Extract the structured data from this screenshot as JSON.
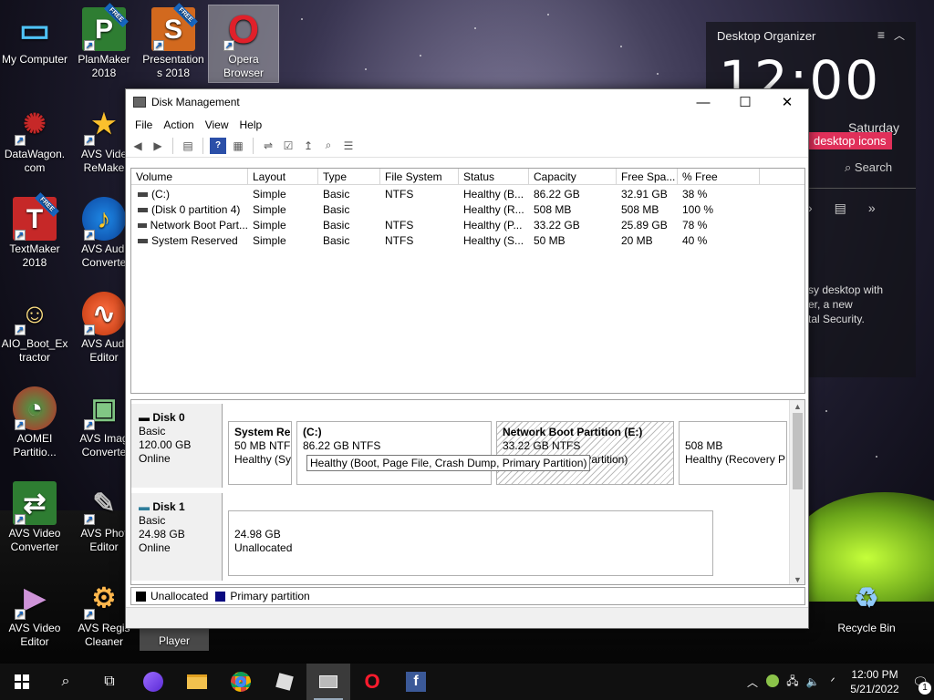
{
  "desktop": {
    "icons": [
      {
        "label": "My Computer",
        "glyph": "▭"
      },
      {
        "label": "PlanMaker 2018",
        "glyph": "P",
        "badge": "FREE"
      },
      {
        "label": "Presentation s 2018",
        "glyph": "S",
        "badge": "FREE"
      },
      {
        "label": "Opera Browser",
        "glyph": "O"
      },
      {
        "label": "DataWagon. com",
        "glyph": "✺"
      },
      {
        "label": "AVS Vide ReMake",
        "glyph": "★"
      },
      {
        "label": "TextMaker 2018",
        "glyph": "T",
        "badge": "FREE"
      },
      {
        "label": "AVS Audi Converte",
        "glyph": "♪"
      },
      {
        "label": "AIO_Boot_Ex tractor",
        "glyph": "☺"
      },
      {
        "label": "AVS Audi Editor",
        "glyph": "∿"
      },
      {
        "label": "AOMEI Partitio...",
        "glyph": "◔"
      },
      {
        "label": "AVS Imag Converte",
        "glyph": "▣"
      },
      {
        "label": "AVS Video Converter",
        "glyph": "⇄"
      },
      {
        "label": "AVS Phot Editor",
        "glyph": "✎"
      },
      {
        "label": "AVS Video Editor",
        "glyph": "▶"
      },
      {
        "label": "AVS Regis Cleaner",
        "glyph": "⚙"
      },
      {
        "label": "Player",
        "glyph": ""
      },
      {
        "label": "Recycle Bin",
        "glyph": "♻"
      }
    ]
  },
  "organizer": {
    "title": "Desktop Organizer",
    "clock": "12:00",
    "day": "Saturday",
    "badge": "desktop icons",
    "search": "Search",
    "text_lines": [
      "sy desktop with",
      "er, a new",
      "tal Security."
    ]
  },
  "window": {
    "title": "Disk Management",
    "menu": [
      "File",
      "Action",
      "View",
      "Help"
    ],
    "columns": [
      "Volume",
      "Layout",
      "Type",
      "File System",
      "Status",
      "Capacity",
      "Free Spa...",
      "% Free"
    ],
    "volumes": [
      {
        "volume": "(C:)",
        "layout": "Simple",
        "type": "Basic",
        "fs": "NTFS",
        "status": "Healthy (B...",
        "capacity": "86.22 GB",
        "free": "32.91 GB",
        "pct": "38 %"
      },
      {
        "volume": "(Disk 0 partition 4)",
        "layout": "Simple",
        "type": "Basic",
        "fs": "",
        "status": "Healthy (R...",
        "capacity": "508 MB",
        "free": "508 MB",
        "pct": "100 %"
      },
      {
        "volume": "Network Boot Part...",
        "layout": "Simple",
        "type": "Basic",
        "fs": "NTFS",
        "status": "Healthy (P...",
        "capacity": "33.22 GB",
        "free": "25.89 GB",
        "pct": "78 %"
      },
      {
        "volume": "System Reserved",
        "layout": "Simple",
        "type": "Basic",
        "fs": "NTFS",
        "status": "Healthy (S...",
        "capacity": "50 MB",
        "free": "20 MB",
        "pct": "40 %"
      }
    ],
    "disks": [
      {
        "name": "Disk 0",
        "type": "Basic",
        "size": "120.00 GB",
        "state": "Online",
        "partitions": [
          {
            "name": "System Re",
            "size": "50 MB NTFS",
            "status": "Healthy (Sy"
          },
          {
            "name": "(C:)",
            "size": "86.22 GB NTFS",
            "status": ""
          },
          {
            "name": "Network Boot Partition  (E:)",
            "size": "33.22 GB NTFS",
            "status": "y Partition)"
          },
          {
            "name": "",
            "size": "508 MB",
            "status": "Healthy (Recovery P"
          }
        ],
        "tooltip": "Healthy (Boot, Page File, Crash Dump, Primary Partition)"
      },
      {
        "name": "Disk 1",
        "type": "Basic",
        "size": "24.98 GB",
        "state": "Online",
        "partitions": [
          {
            "name": "",
            "size": "24.98 GB",
            "status": "Unallocated"
          }
        ]
      }
    ],
    "legend": [
      "Unallocated",
      "Primary partition"
    ],
    "colors": {
      "unallocated": "#000000",
      "primary": "#0a0a80"
    }
  },
  "taskbar": {
    "time": "12:00 PM",
    "date": "5/21/2022",
    "notifications": "1"
  }
}
